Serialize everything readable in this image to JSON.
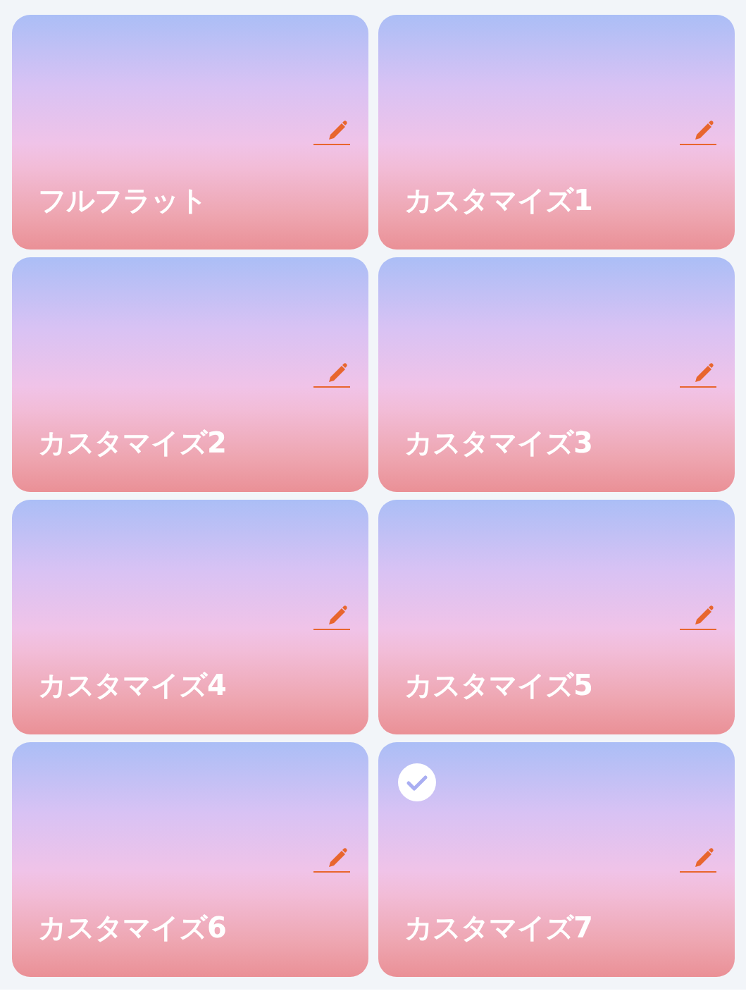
{
  "presets": [
    {
      "name": "フルフラット",
      "selected": false
    },
    {
      "name": "カスタマイズ1",
      "selected": false
    },
    {
      "name": "カスタマイズ2",
      "selected": false
    },
    {
      "name": "カスタマイズ3",
      "selected": false
    },
    {
      "name": "カスタマイズ4",
      "selected": false
    },
    {
      "name": "カスタマイズ5",
      "selected": false
    },
    {
      "name": "カスタマイズ6",
      "selected": false
    },
    {
      "name": "カスタマイズ7",
      "selected": true
    }
  ]
}
